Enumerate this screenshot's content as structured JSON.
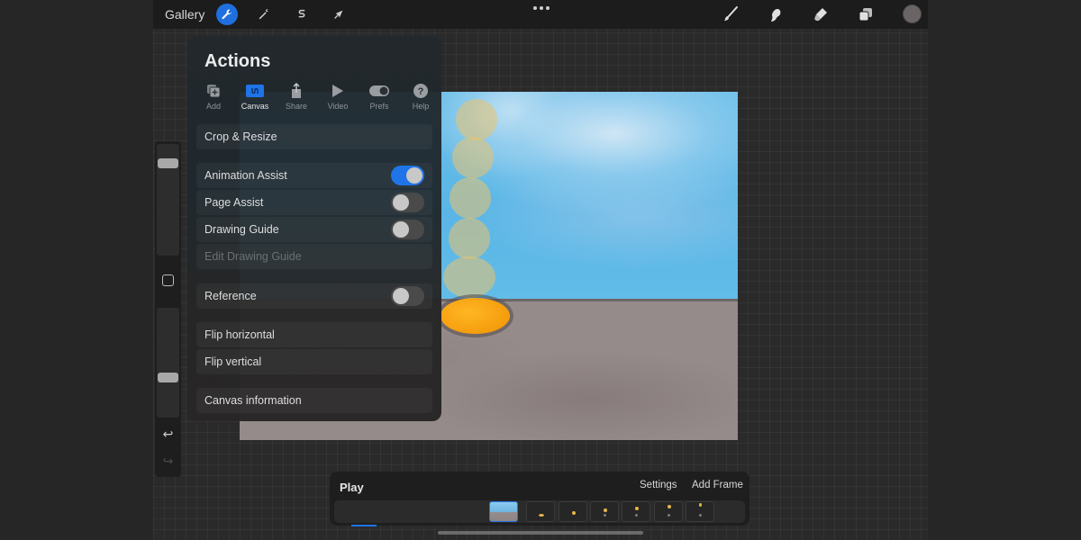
{
  "topbar": {
    "gallery_label": "Gallery",
    "left_tools": [
      {
        "name": "actions",
        "icon": "wrench-icon",
        "active": true
      },
      {
        "name": "adjustments",
        "icon": "magic-wand-icon",
        "active": false
      },
      {
        "name": "selection",
        "icon": "selection-s-icon",
        "active": false
      },
      {
        "name": "transform",
        "icon": "arrow-cursor-icon",
        "active": false
      }
    ],
    "more_icon": "ellipsis-icon",
    "right_tools": [
      {
        "name": "brush",
        "icon": "paintbrush-icon"
      },
      {
        "name": "smudge",
        "icon": "smudge-finger-icon"
      },
      {
        "name": "eraser",
        "icon": "eraser-icon"
      },
      {
        "name": "layers",
        "icon": "layers-icon"
      }
    ],
    "current_color": "#6a6464"
  },
  "sidebar": {
    "brush_size_value": 0.95,
    "opacity_value": 0.15,
    "modify_icon": "square-icon",
    "undo_icon": "undo-icon",
    "redo_icon": "redo-icon"
  },
  "actions": {
    "title": "Actions",
    "tabs": [
      {
        "label": "Add",
        "icon": "add-icon",
        "active": false
      },
      {
        "label": "Canvas",
        "icon": "canvas-icon",
        "active": true
      },
      {
        "label": "Share",
        "icon": "share-icon",
        "active": false
      },
      {
        "label": "Video",
        "icon": "play-icon",
        "active": false
      },
      {
        "label": "Prefs",
        "icon": "toggle-icon",
        "active": false
      },
      {
        "label": "Help",
        "icon": "help-icon",
        "active": false
      }
    ],
    "items": [
      {
        "label": "Crop & Resize"
      },
      {
        "label": "Animation Assist",
        "toggle": true
      },
      {
        "label": "Page Assist",
        "toggle": false
      },
      {
        "label": "Drawing Guide",
        "toggle": false
      },
      {
        "label": "Edit Drawing Guide",
        "disabled": true
      },
      {
        "label": "Reference",
        "toggle": false
      },
      {
        "label": "Flip horizontal"
      },
      {
        "label": "Flip vertical"
      },
      {
        "label": "Canvas information"
      }
    ]
  },
  "timeline": {
    "play_label": "Play",
    "settings_label": "Settings",
    "add_frame_label": "Add Frame",
    "frame_count": 7,
    "selected_frame": 1
  },
  "colors": {
    "accent": "#1f74e8",
    "panel_text": "#dedede"
  }
}
